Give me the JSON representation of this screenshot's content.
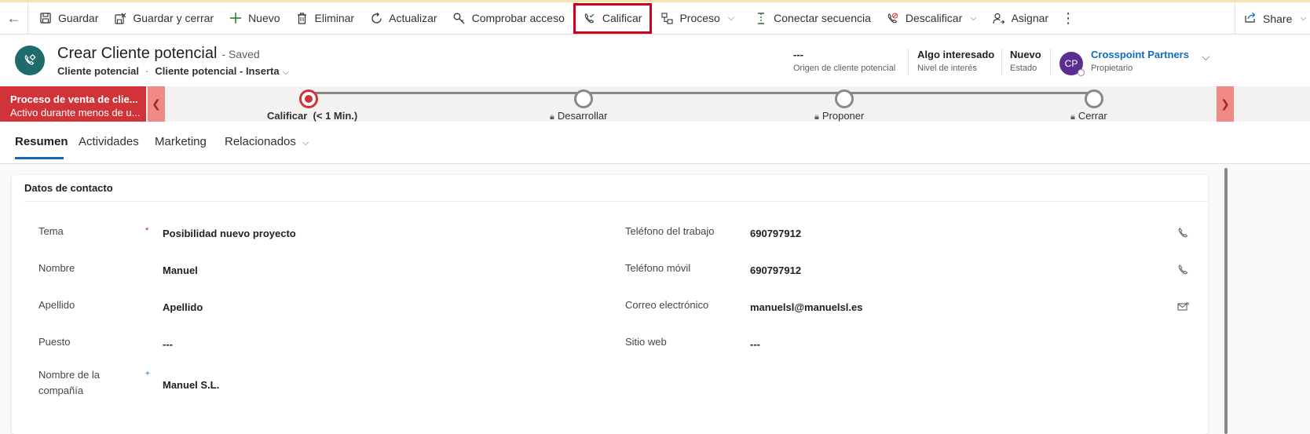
{
  "commandbar": {
    "back_label": "←",
    "items": [
      {
        "label": "Guardar",
        "icon": "save-icon"
      },
      {
        "label": "Guardar y cerrar",
        "icon": "save-close-icon"
      },
      {
        "label": "Nuevo",
        "icon": "plus-icon"
      },
      {
        "label": "Eliminar",
        "icon": "trash-icon"
      },
      {
        "label": "Actualizar",
        "icon": "refresh-icon"
      },
      {
        "label": "Comprobar acceso",
        "icon": "key-icon"
      },
      {
        "label": "Calificar",
        "icon": "phone-check-icon",
        "highlighted": true
      },
      {
        "label": "Proceso",
        "icon": "process-icon"
      },
      {
        "label": "Conectar secuencia",
        "icon": "sequence-icon"
      },
      {
        "label": "Descalificar",
        "icon": "phone-cancel-icon"
      },
      {
        "label": "Asignar",
        "icon": "person-assign-icon"
      }
    ],
    "more_label": "⋮",
    "share_label": "Share"
  },
  "header": {
    "title": "Crear Cliente potencial",
    "saved_status": "- Saved",
    "entity": "Cliente potencial",
    "form": "Cliente potencial - Inserta",
    "fields": [
      {
        "value": "---",
        "label": "Origen de cliente potencial"
      },
      {
        "value": "Algo interesado",
        "label": "Nivel de interés"
      },
      {
        "value": "Nuevo",
        "label": "Estado"
      }
    ],
    "owner": {
      "initials": "CP",
      "name": "Crosspoint Partners",
      "label": "Propietario",
      "avatar_color": "#5c2d91"
    }
  },
  "bpf": {
    "process_name": "Proceso de venta de clie...",
    "process_status": "Activo durante menos de u...",
    "stages": [
      {
        "label": "Calificar",
        "duration": "(< 1 Min.)",
        "active": true
      },
      {
        "label": "Desarrollar",
        "active": false
      },
      {
        "label": "Proponer",
        "active": false
      },
      {
        "label": "Cerrar",
        "active": false
      }
    ],
    "accent": "#d13438"
  },
  "tabs": [
    {
      "label": "Resumen",
      "active": true
    },
    {
      "label": "Actividades"
    },
    {
      "label": "Marketing"
    },
    {
      "label": "Relacionados"
    }
  ],
  "section": {
    "title": "Datos de contacto",
    "left_fields": [
      {
        "label": "Tema",
        "value": "Posibilidad nuevo proyecto",
        "required": "*"
      },
      {
        "label": "Nombre",
        "value": "Manuel"
      },
      {
        "label": "Apellido",
        "value": "Apellido"
      },
      {
        "label": "Puesto",
        "value": "---"
      },
      {
        "label": "Nombre de la compañía",
        "value": "Manuel S.L.",
        "recommended": "+"
      }
    ],
    "right_fields": [
      {
        "label": "Teléfono del trabajo",
        "value": "690797912",
        "icon": "phone-icon"
      },
      {
        "label": "Teléfono móvil",
        "value": "690797912",
        "icon": "phone-icon"
      },
      {
        "label": "Correo electrónico",
        "value": "manuelsl@manuelsl.es",
        "icon": "email-icon"
      },
      {
        "label": "Sitio web",
        "value": "---"
      }
    ]
  }
}
